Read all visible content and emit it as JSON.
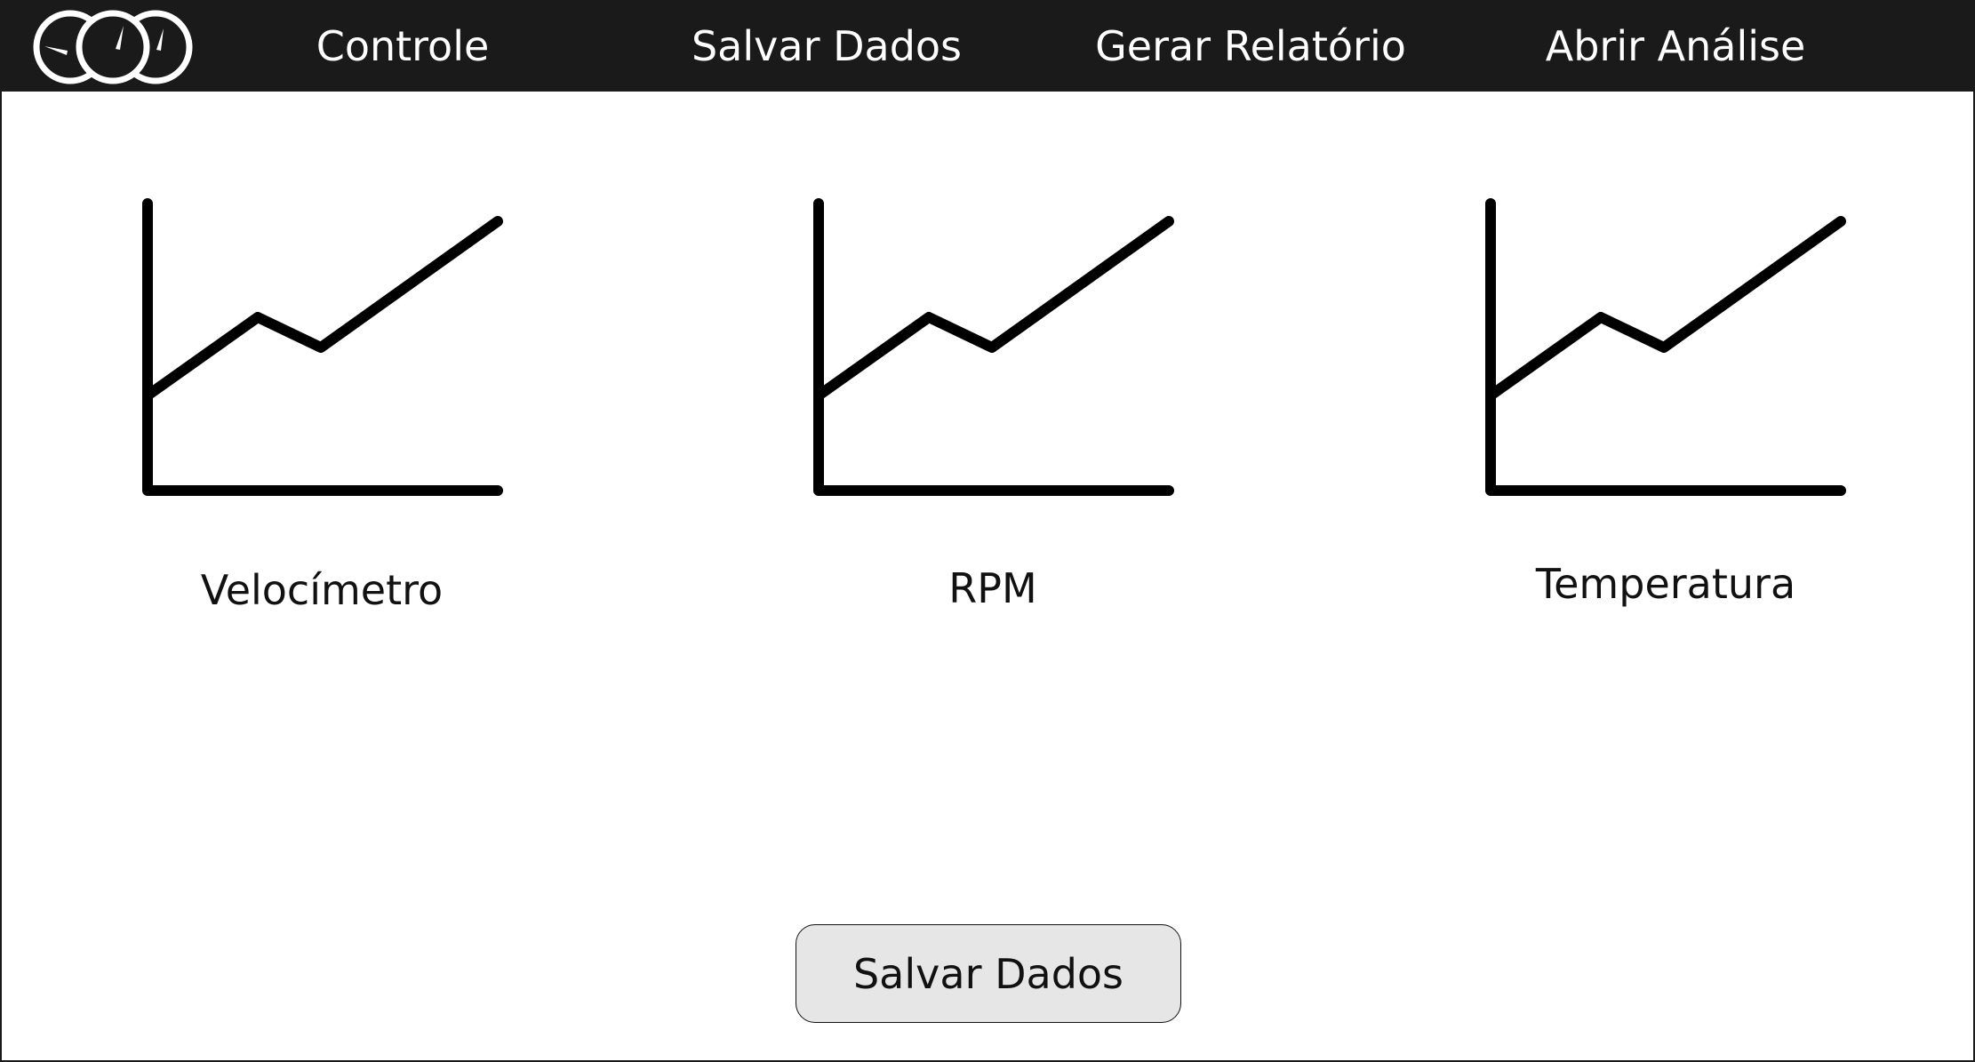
{
  "nav": {
    "logo_icon": "gauges-logo-icon",
    "items": [
      {
        "label": "Controle"
      },
      {
        "label": "Salvar Dados"
      },
      {
        "label": "Gerar Relatório"
      },
      {
        "label": "Abrir Análise"
      }
    ]
  },
  "panels": [
    {
      "label": "Velocímetro",
      "icon": "line-chart-icon"
    },
    {
      "label": "RPM",
      "icon": "line-chart-icon"
    },
    {
      "label": "Temperatura",
      "icon": "line-chart-icon"
    }
  ],
  "actions": {
    "save_label": "Salvar Dados"
  },
  "colors": {
    "topbar": "#1a1a1a",
    "nav_text": "#ffffff",
    "button_bg": "#e6e6e6"
  }
}
